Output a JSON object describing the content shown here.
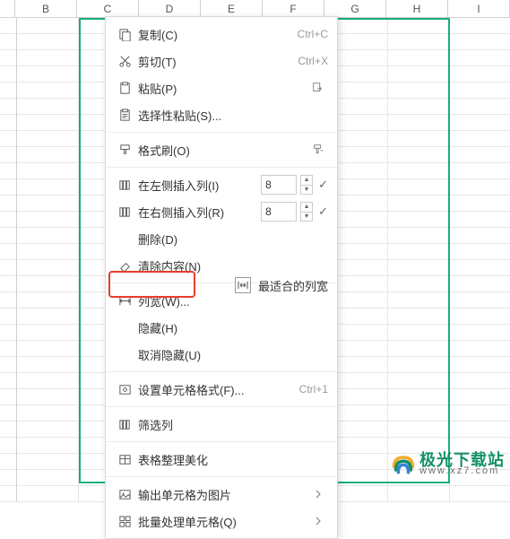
{
  "columns": [
    "B",
    "C",
    "D",
    "E",
    "F",
    "G",
    "H",
    "I"
  ],
  "menu": {
    "copy": "复制(C)",
    "copy_sc": "Ctrl+C",
    "cut": "剪切(T)",
    "cut_sc": "Ctrl+X",
    "paste": "粘贴(P)",
    "paste_special": "选择性粘贴(S)...",
    "format_painter": "格式刷(O)",
    "insert_left": "在左侧插入列(I)",
    "insert_right": "在右侧插入列(R)",
    "insert_left_val": "8",
    "insert_right_val": "8",
    "delete": "删除(D)",
    "clear": "清除内容(N)",
    "col_width": "列宽(W)...",
    "autofit": "最适合的列宽",
    "hide": "隐藏(H)",
    "unhide": "取消隐藏(U)",
    "cell_format": "设置单元格格式(F)...",
    "cell_format_sc": "Ctrl+1",
    "filter_col": "筛选列",
    "table_beautify": "表格整理美化",
    "output_img": "输出单元格为图片",
    "batch": "批量处理单元格(Q)"
  },
  "watermark": {
    "title": "极光下载站",
    "sub": "www.xz7.com"
  }
}
